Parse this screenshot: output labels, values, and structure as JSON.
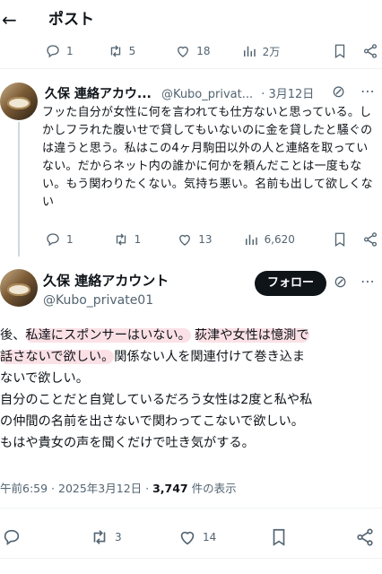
{
  "header": {
    "back_icon": "←",
    "title": "ポスト"
  },
  "actions_top": {
    "reply": "1",
    "repost": "5",
    "like": "18",
    "views": "2万"
  },
  "reply_tweet": {
    "name": "久保 連絡アカウ...",
    "handle": "@Kubo_privat...",
    "date": "· 3月12日",
    "text": "フッた自分が女性に何を言われても仕方ないと思っている。しかしフラれた腹いせで貸してもいないのに金を貸したと騒ぐのは違うと思う。私はこの4ヶ月駒田以外の人と連絡を取っていない。だからネット内の誰かに何かを頼んだことは一度もない。もう関わりたくない。気持ち悪い。名前も出して欲しくない",
    "actions": {
      "reply": "1",
      "repost": "1",
      "like": "13",
      "views": "6,620"
    }
  },
  "main_tweet": {
    "name": "久保 連絡アカウント",
    "handle": "@Kubo_private01",
    "follow_label": "フォロー",
    "text": {
      "p1_pre": "後、",
      "p1_hl1": "私達にスポンサーはいない。",
      "p1_hl2": "荻津や女性は憶測で",
      "p2_hl": "話さないで欲しい。",
      "p2_rest": "関係ない人を関連付けて巻き込ま",
      "p3": "ないで欲しい。",
      "p4": "自分のことだと自覚しているだろう女性は2度と私や私",
      "p5": "の仲間の名前を出さないで関わってこないで欲しい。",
      "p6": "もはや貴女の声を聞くだけで吐き気がする。"
    },
    "meta_time": "午前6:59 · 2025年3月12日 · ",
    "meta_views": "3,747",
    "meta_views_suffix": " 件の表示",
    "actions": {
      "repost": "3",
      "like": "14"
    }
  },
  "colors": {
    "text": "#0f1419",
    "secondary": "#536471",
    "highlight": "#ee788c"
  }
}
